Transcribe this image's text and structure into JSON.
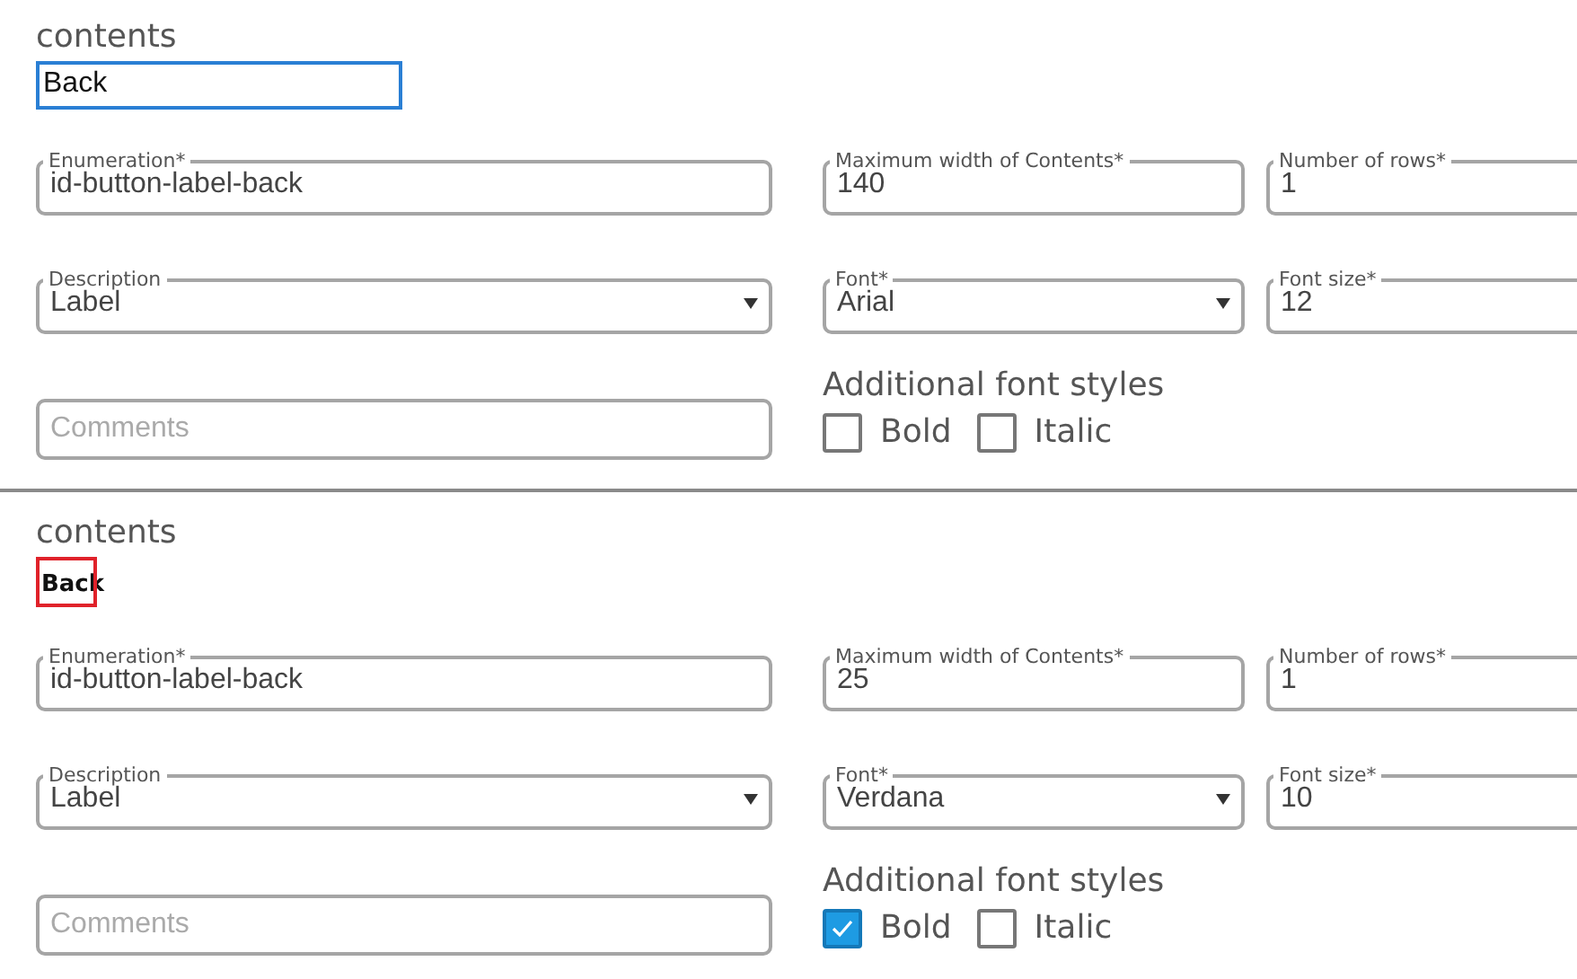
{
  "sections": [
    {
      "title": "contents",
      "preview": {
        "kind": "input",
        "text": "Back"
      },
      "fields": [
        {
          "kind": "text",
          "label": "Enumeration*",
          "value": "id-button-label-back"
        },
        {
          "kind": "text",
          "label": "Maximum width of Contents*",
          "value": "140"
        },
        {
          "kind": "text",
          "label": "Number of rows*",
          "value": "1"
        },
        {
          "kind": "select",
          "label": "Description",
          "value": "Label"
        },
        {
          "kind": "select",
          "label": "Font*",
          "value": "Arial"
        },
        {
          "kind": "select",
          "label": "Font size*",
          "value": "12"
        }
      ],
      "comments": {
        "placeholder": "Comments"
      },
      "font_styles": {
        "label": "Additional font styles",
        "options": [
          {
            "label": "Bold",
            "checked": false
          },
          {
            "label": "Italic",
            "checked": false
          }
        ]
      }
    },
    {
      "title": "contents",
      "preview": {
        "kind": "clipped",
        "text": "Back"
      },
      "fields": [
        {
          "kind": "text",
          "label": "Enumeration*",
          "value": "id-button-label-back"
        },
        {
          "kind": "text",
          "label": "Maximum width of Contents*",
          "value": "25"
        },
        {
          "kind": "text",
          "label": "Number of rows*",
          "value": "1"
        },
        {
          "kind": "select",
          "label": "Description",
          "value": "Label"
        },
        {
          "kind": "select",
          "label": "Font*",
          "value": "Verdana"
        },
        {
          "kind": "select",
          "label": "Font size*",
          "value": "10"
        }
      ],
      "comments": {
        "placeholder": "Comments"
      },
      "font_styles": {
        "label": "Additional font styles",
        "options": [
          {
            "label": "Bold",
            "checked": true
          },
          {
            "label": "Italic",
            "checked": false
          }
        ]
      }
    }
  ]
}
